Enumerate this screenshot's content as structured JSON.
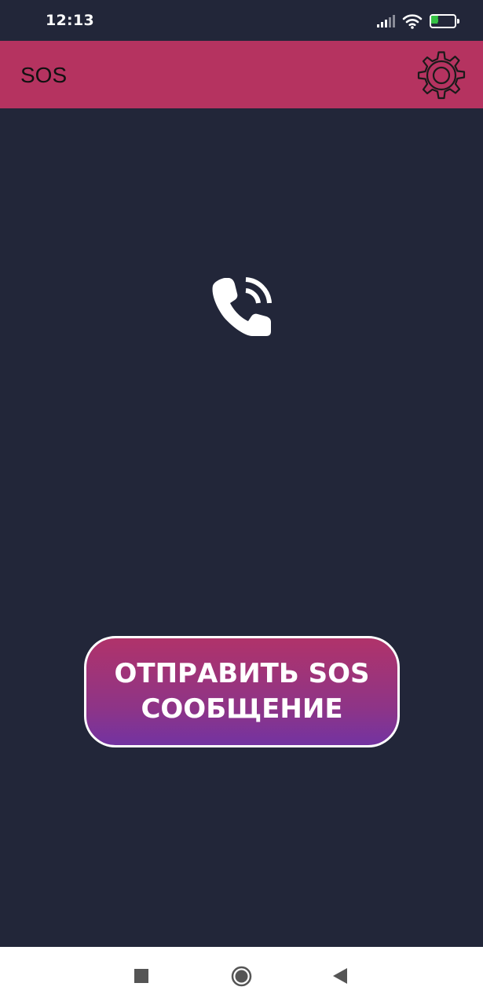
{
  "status_bar": {
    "time": "12:13",
    "battery_level": "34",
    "icons": [
      "signal-icon",
      "wifi-icon",
      "battery-icon"
    ]
  },
  "app_bar": {
    "title": "SOS",
    "settings_icon": "gear-icon"
  },
  "main": {
    "call_icon": "phone-calling-icon",
    "sos_button_label": "ОТПРАВИТЬ SOS\nСООБЩЕНИЕ"
  },
  "nav_bar": {
    "icons": [
      "recent-apps-icon",
      "home-icon",
      "back-icon"
    ]
  },
  "colors": {
    "background": "#222639",
    "app_bar": "#b53360",
    "button_gradient_top": "#b0336a",
    "button_gradient_bottom": "#7333a1",
    "battery_fill": "#35c144"
  }
}
